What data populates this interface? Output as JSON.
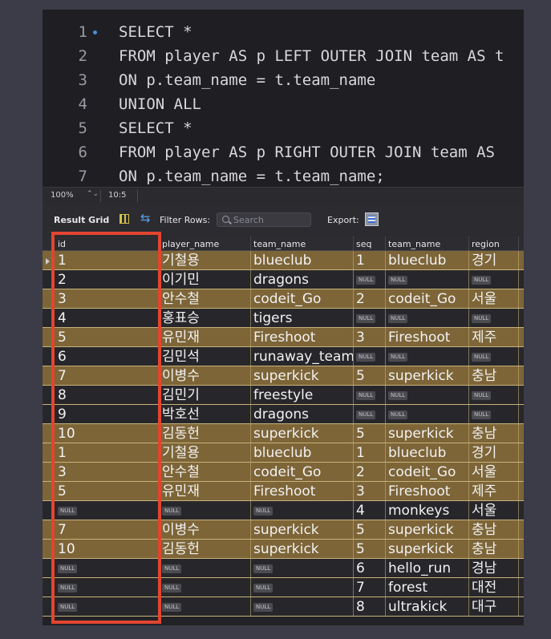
{
  "editor": {
    "lines": [
      {
        "num": "1",
        "text": "SELECT *"
      },
      {
        "num": "2",
        "text": "FROM player AS p LEFT OUTER JOIN team AS t"
      },
      {
        "num": "3",
        "text": "ON p.team_name = t.team_name"
      },
      {
        "num": "4",
        "text": "UNION ALL"
      },
      {
        "num": "5",
        "text": "SELECT *"
      },
      {
        "num": "6",
        "text": "FROM player AS p RIGHT OUTER JOIN team AS"
      },
      {
        "num": "7",
        "text": "ON p.team_name = t.team_name;"
      }
    ]
  },
  "status": {
    "zoom": "100%",
    "cursor": "10:5"
  },
  "toolbar": {
    "result_grid": "Result Grid",
    "filter_rows": "Filter Rows:",
    "search_placeholder": "Search",
    "export": "Export:"
  },
  "grid": {
    "columns": [
      "id",
      "player_name",
      "team_name",
      "seq",
      "team_name",
      "region"
    ],
    "null_label": "NULL",
    "rows": [
      {
        "hl": true,
        "cells": [
          "1",
          "기철용",
          "blueclub",
          "1",
          "blueclub",
          "경기"
        ]
      },
      {
        "hl": false,
        "cells": [
          "2",
          "이기민",
          "dragons",
          null,
          null,
          null
        ]
      },
      {
        "hl": true,
        "cells": [
          "3",
          "안수철",
          "codeit_Go",
          "2",
          "codeit_Go",
          "서울"
        ]
      },
      {
        "hl": false,
        "cells": [
          "4",
          "홍표승",
          "tigers",
          null,
          null,
          null
        ]
      },
      {
        "hl": true,
        "cells": [
          "5",
          "유민재",
          "Fireshoot",
          "3",
          "Fireshoot",
          "제주"
        ]
      },
      {
        "hl": false,
        "cells": [
          "6",
          "김민석",
          "runaway_team",
          null,
          null,
          null
        ]
      },
      {
        "hl": true,
        "cells": [
          "7",
          "이병수",
          "superkick",
          "5",
          "superkick",
          "충남"
        ]
      },
      {
        "hl": false,
        "cells": [
          "8",
          "김민기",
          "freestyle",
          null,
          null,
          null
        ]
      },
      {
        "hl": false,
        "cells": [
          "9",
          "박호선",
          "dragons",
          null,
          null,
          null
        ]
      },
      {
        "hl": true,
        "cells": [
          "10",
          "김동헌",
          "superkick",
          "5",
          "superkick",
          "충남"
        ]
      },
      {
        "hl": true,
        "cells": [
          "1",
          "기철용",
          "blueclub",
          "1",
          "blueclub",
          "경기"
        ]
      },
      {
        "hl": true,
        "cells": [
          "3",
          "안수철",
          "codeit_Go",
          "2",
          "codeit_Go",
          "서울"
        ]
      },
      {
        "hl": true,
        "cells": [
          "5",
          "유민재",
          "Fireshoot",
          "3",
          "Fireshoot",
          "제주"
        ]
      },
      {
        "hl": false,
        "cells": [
          null,
          null,
          null,
          "4",
          "monkeys",
          "서울"
        ]
      },
      {
        "hl": true,
        "cells": [
          "7",
          "이병수",
          "superkick",
          "5",
          "superkick",
          "충남"
        ]
      },
      {
        "hl": true,
        "cells": [
          "10",
          "김동헌",
          "superkick",
          "5",
          "superkick",
          "충남"
        ]
      },
      {
        "hl": false,
        "cells": [
          null,
          null,
          null,
          "6",
          "hello_run",
          "경남"
        ]
      },
      {
        "hl": false,
        "cells": [
          null,
          null,
          null,
          "7",
          "forest",
          "대전"
        ]
      },
      {
        "hl": false,
        "cells": [
          null,
          null,
          null,
          "8",
          "ultrakick",
          "대구"
        ]
      }
    ]
  },
  "colors": {
    "highlight_row": "#7d6538",
    "annotation_box": "#e2452f",
    "keyword": "#4a8fd8"
  }
}
